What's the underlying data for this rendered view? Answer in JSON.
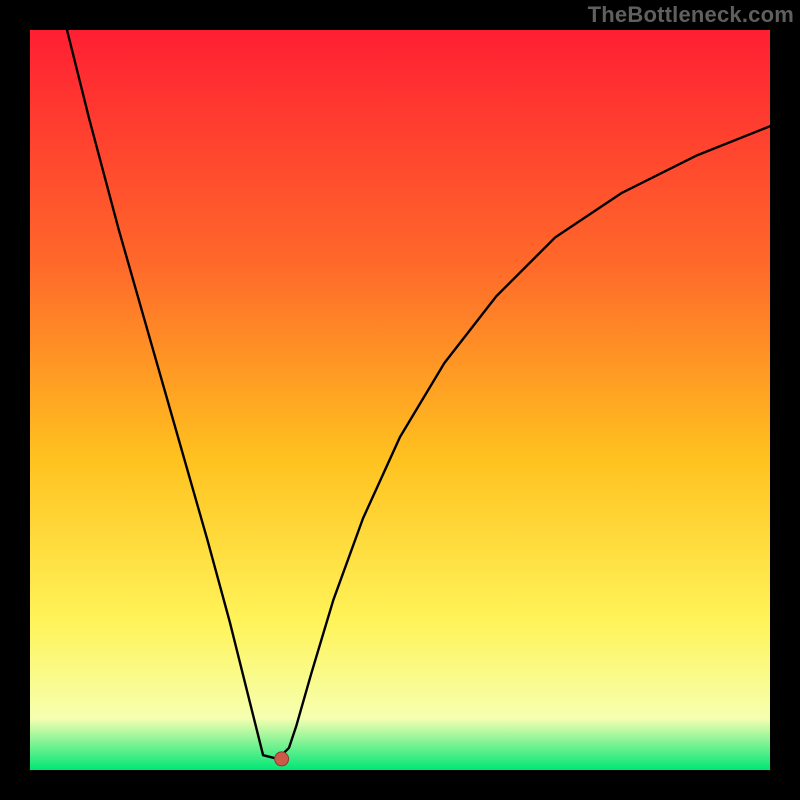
{
  "attribution": "TheBottleneck.com",
  "colors": {
    "bg": "#000000",
    "attribution_text": "#5f5f5f",
    "gradient_top": "#ff1f33",
    "gradient_upper_mid": "#ff6a2a",
    "gradient_mid": "#ffc21f",
    "gradient_lower_mid": "#fff45a",
    "gradient_pale": "#f6ffb0",
    "gradient_bottom": "#00e676",
    "curve": "#000000",
    "marker_fill": "#cc5a4a",
    "marker_stroke": "#8f3a30"
  },
  "chart_data": {
    "type": "line",
    "title": "",
    "xlabel": "",
    "ylabel": "",
    "xlim": [
      0,
      100
    ],
    "ylim": [
      0,
      100
    ],
    "grid": false,
    "note": "Values are read off the image in percent-of-axis units; 0,0 is bottom-left of the colored plot area.",
    "series": [
      {
        "name": "curve",
        "x": [
          5,
          8,
          12,
          16,
          20,
          24,
          27,
          29,
          30.5,
          31.5,
          33.5,
          35,
          36,
          38,
          41,
          45,
          50,
          56,
          63,
          71,
          80,
          90,
          100
        ],
        "y": [
          100,
          88,
          73,
          59,
          45,
          31,
          20,
          12,
          6,
          2,
          1.5,
          3,
          6,
          13,
          23,
          34,
          45,
          55,
          64,
          72,
          78,
          83,
          87
        ]
      }
    ],
    "flat_bottom": {
      "x_start": 31.5,
      "x_end": 33.5,
      "y": 1.5
    },
    "marker": {
      "x": 34,
      "y": 1.5,
      "label": ""
    }
  }
}
